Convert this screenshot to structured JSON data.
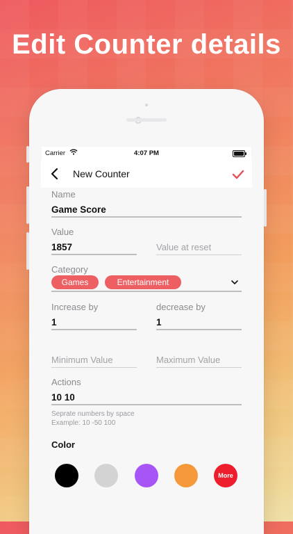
{
  "headline": "Edit Counter details",
  "status_bar": {
    "carrier": "Carrier",
    "time": "4:07 PM"
  },
  "nav": {
    "title": "New Counter"
  },
  "form": {
    "name": {
      "label": "Name",
      "value": "Game Score"
    },
    "value": {
      "label": "Value",
      "value": "1857"
    },
    "value_at_reset": {
      "placeholder": "Value at reset"
    },
    "category": {
      "label": "Category",
      "tags": [
        "Games",
        "Entertainment"
      ]
    },
    "increase_by": {
      "label": "Increase by",
      "value": "1"
    },
    "decrease_by": {
      "label": "decrease by",
      "value": "1"
    },
    "minimum_value": {
      "placeholder": "Minimum Value"
    },
    "maximum_value": {
      "placeholder": "Maximum Value"
    },
    "actions": {
      "label": "Actions",
      "value": "10 10",
      "hint_line1": "Seprate numbers by space",
      "hint_line2": "Example: 10 -50 100"
    },
    "color": {
      "label": "Color",
      "swatches": [
        "#000000",
        "#d3d3d3",
        "#a855f7",
        "#f5993a",
        "#ee1f2c"
      ],
      "more_label": "More"
    }
  },
  "colors": {
    "accent": "#ee5f63",
    "checkmark": "#e0505c"
  },
  "icons": [
    "back-chevron-icon",
    "checkmark-icon",
    "wifi-icon",
    "battery-icon",
    "dropdown-chevron-icon"
  ]
}
